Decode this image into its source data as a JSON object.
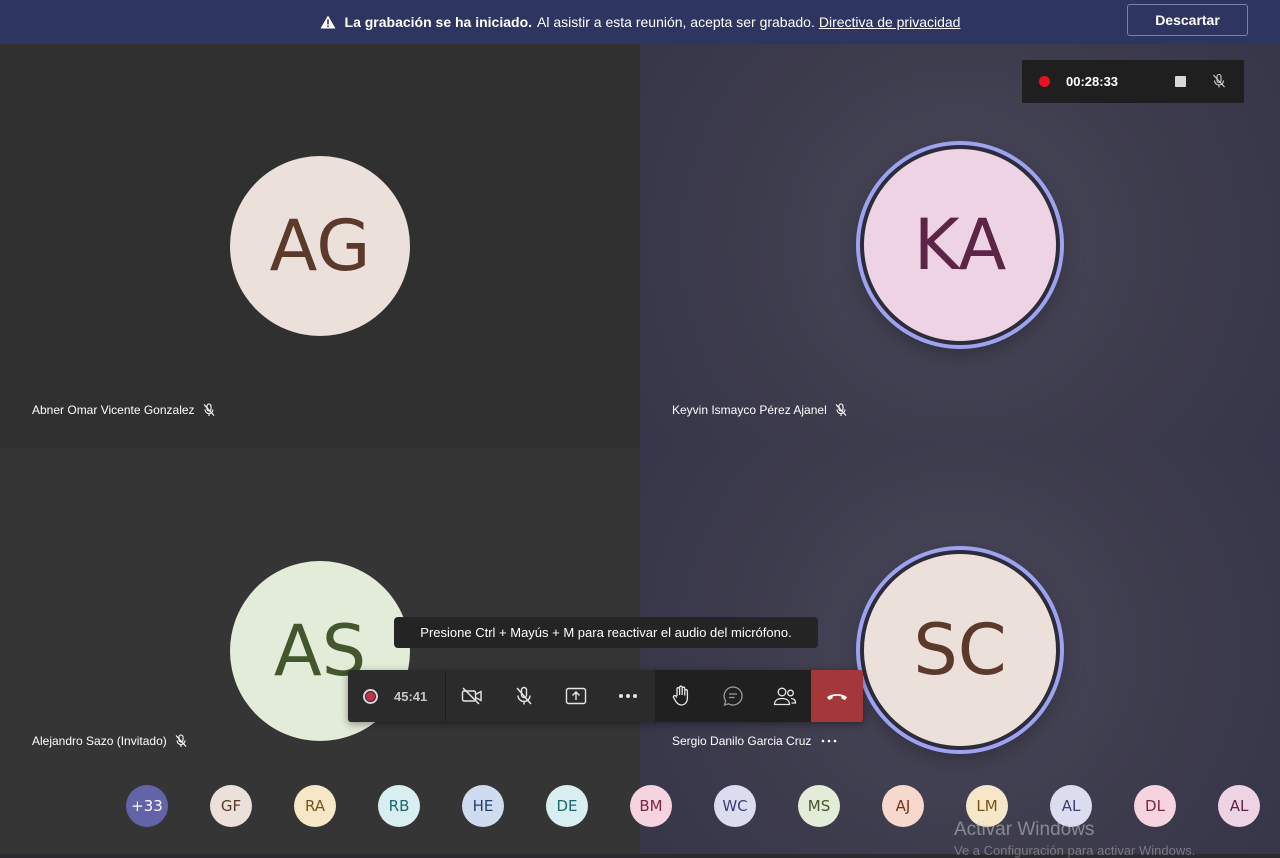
{
  "banner": {
    "bold_text": "La grabación se ha iniciado.",
    "text": "Al asistir a esta reunión, acepta ser grabado.",
    "link": "Directiva de privacidad",
    "dismiss_label": "Descartar"
  },
  "recording": {
    "time": "00:28:33"
  },
  "participants": [
    {
      "initials": "AG",
      "name": "Abner Omar Vicente Gonzalez",
      "bg": "#ece0da",
      "fg": "#5b3a2b"
    },
    {
      "initials": "KA",
      "name": "Keyvin Ismayco Pérez Ajanel",
      "bg": "#edd3e3",
      "fg": "#5c2445"
    },
    {
      "initials": "AS",
      "name": "Alejandro Sazo (Invitado)",
      "bg": "#e3ebd9",
      "fg": "#43562d"
    },
    {
      "initials": "SC",
      "name": "Sergio Danilo Garcia Cruz",
      "bg": "#ece0da",
      "fg": "#5b3a2b"
    }
  ],
  "tooltip": "Presione Ctrl + Mayús + M para reactivar el audio del micrófono.",
  "toolbar": {
    "duration": "45:41"
  },
  "strip": [
    {
      "initials": "+33",
      "bg": "#6264a7",
      "fg": "#ffffff"
    },
    {
      "initials": "GF",
      "bg": "#ece0da",
      "fg": "#5b3a2b"
    },
    {
      "initials": "RA",
      "bg": "#f6e7c8",
      "fg": "#7a5317"
    },
    {
      "initials": "RB",
      "bg": "#d9eef0",
      "fg": "#1c6670"
    },
    {
      "initials": "HE",
      "bg": "#cfdcf0",
      "fg": "#223f6e"
    },
    {
      "initials": "DE",
      "bg": "#d9eef0",
      "fg": "#1c6670"
    },
    {
      "initials": "BM",
      "bg": "#f5d3df",
      "fg": "#7a2645"
    },
    {
      "initials": "WC",
      "bg": "#dcdcf0",
      "fg": "#3e3e78"
    },
    {
      "initials": "MS",
      "bg": "#e3ebd9",
      "fg": "#43562d"
    },
    {
      "initials": "AJ",
      "bg": "#f7d8cd",
      "fg": "#7a2e17"
    },
    {
      "initials": "LM",
      "bg": "#f6e7c8",
      "fg": "#7a5317"
    },
    {
      "initials": "AL",
      "bg": "#dcdcf0",
      "fg": "#3e3e78"
    },
    {
      "initials": "DL",
      "bg": "#f5d3df",
      "fg": "#7a2645"
    },
    {
      "initials": "AL",
      "bg": "#edd3e3",
      "fg": "#5c2445"
    }
  ],
  "watermark": {
    "line1": "Activar Windows",
    "line2": "Ve a Configuración para activar Windows."
  }
}
